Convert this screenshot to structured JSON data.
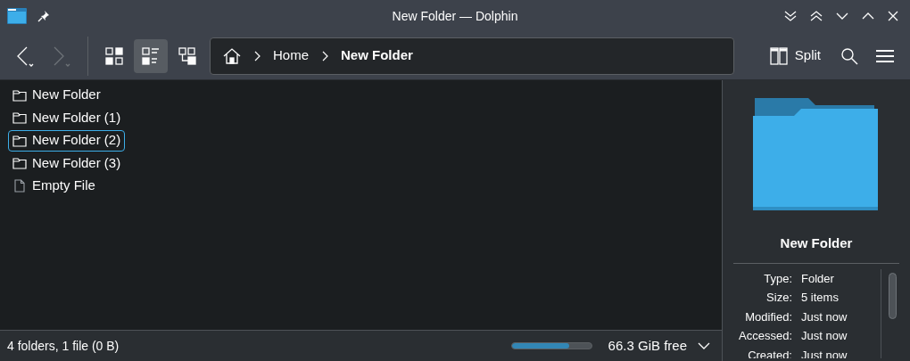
{
  "window": {
    "title": "New Folder — Dolphin"
  },
  "toolbar": {
    "view_modes": [
      {
        "kind": "icons",
        "selected": false
      },
      {
        "kind": "details",
        "selected": true
      },
      {
        "kind": "tree",
        "selected": false
      }
    ],
    "breadcrumb": [
      {
        "label": "Home",
        "current": false
      },
      {
        "label": "New Folder",
        "current": true
      }
    ],
    "split_label": "Split"
  },
  "files": [
    {
      "name": "New Folder",
      "kind": "folder",
      "selected": false
    },
    {
      "name": "New Folder (1)",
      "kind": "folder",
      "selected": false
    },
    {
      "name": "New Folder (2)",
      "kind": "folder",
      "selected": true
    },
    {
      "name": "New Folder (3)",
      "kind": "folder",
      "selected": false
    },
    {
      "name": "Empty File",
      "kind": "file",
      "selected": false
    }
  ],
  "info_panel": {
    "name": "New Folder",
    "properties": [
      {
        "label": "Type:",
        "value": "Folder"
      },
      {
        "label": "Size:",
        "value": "5 items"
      },
      {
        "label": "Modified:",
        "value": "Just now"
      },
      {
        "label": "Accessed:",
        "value": "Just now"
      },
      {
        "label": "Created:",
        "value": "Just now"
      }
    ]
  },
  "status_bar": {
    "summary": "4 folders, 1 file (0 B)",
    "disk": {
      "level": 0.72,
      "free": "66.3 GiB free"
    }
  }
}
